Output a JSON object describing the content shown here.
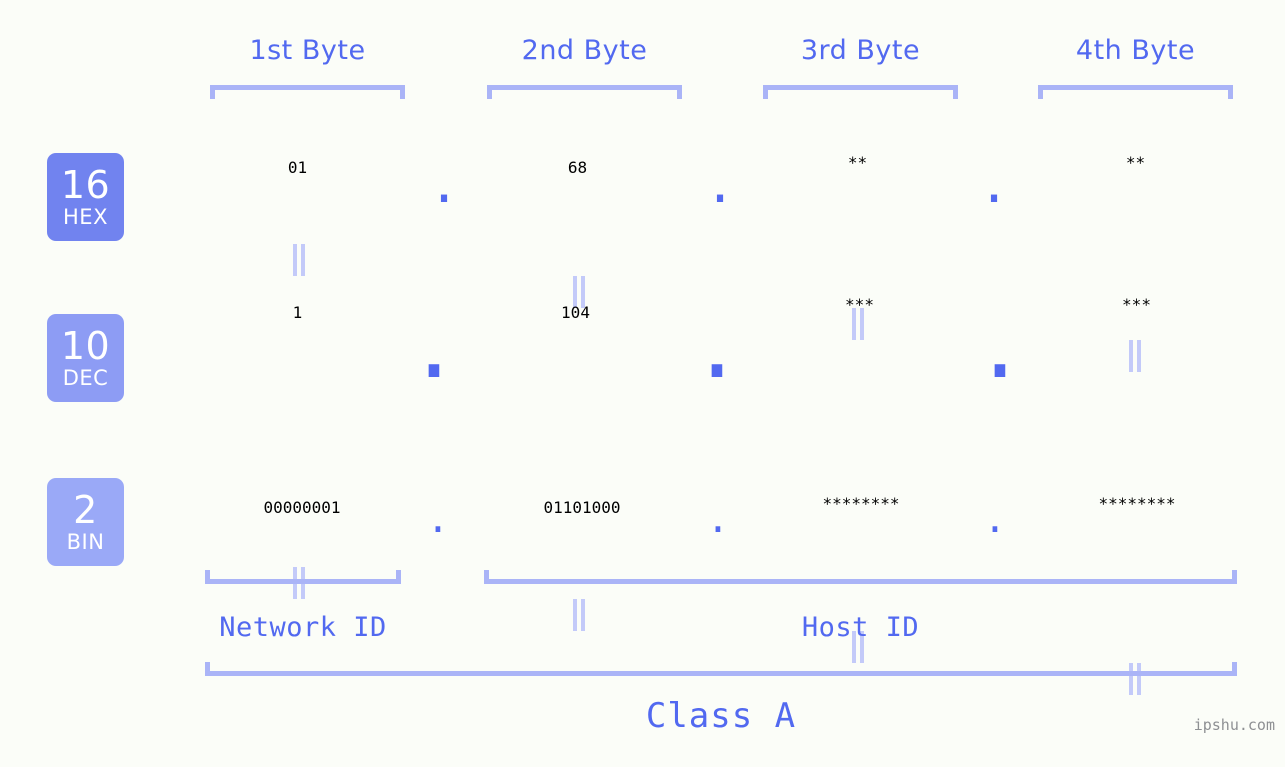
{
  "meta": {
    "watermark": "ipshu.com",
    "background_color": "#fbfdf8",
    "accent_strong": "#5269f0",
    "accent_mid": "#8d9cf4",
    "accent_light": "#aab4f7",
    "connector_color": "#c3caf9"
  },
  "headers": {
    "bytes": [
      {
        "label": "1st Byte"
      },
      {
        "label": "2nd Byte"
      },
      {
        "label": "3rd Byte"
      },
      {
        "label": "4th Byte"
      }
    ]
  },
  "bases": [
    {
      "number": "16",
      "abbr": "HEX",
      "color": "#7183ef"
    },
    {
      "number": "10",
      "abbr": "DEC",
      "color": "#8d9cf4"
    },
    {
      "number": "2",
      "abbr": "BIN",
      "color": "#9aa9f7"
    }
  ],
  "rows": {
    "hex": {
      "base_number": "16",
      "base_abbr": "HEX",
      "values": [
        "01",
        "68",
        "**",
        "**"
      ],
      "separators": [
        ".",
        ".",
        "."
      ]
    },
    "dec": {
      "base_number": "10",
      "base_abbr": "DEC",
      "values": [
        "1",
        "104",
        "***",
        "***"
      ],
      "separators": [
        ".",
        ".",
        "."
      ]
    },
    "bin": {
      "base_number": "2",
      "base_abbr": "BIN",
      "values": [
        "00000001",
        "01101000",
        "********",
        "********"
      ],
      "separators": [
        ".",
        ".",
        "."
      ]
    }
  },
  "connectors": {
    "symbol": "||",
    "hex_to_dec_count": 4,
    "dec_to_bin_count": 4
  },
  "segments": {
    "network_id": "Network ID",
    "host_id": "Host ID",
    "class": "Class A"
  }
}
